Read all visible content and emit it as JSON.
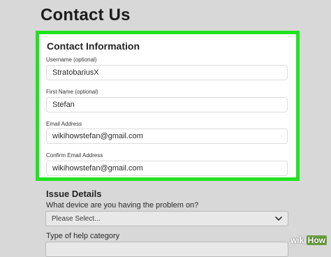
{
  "page": {
    "title": "Contact Us"
  },
  "contact_info": {
    "heading": "Contact Information",
    "fields": [
      {
        "label": "Username (optional)",
        "value": "StratobariusX"
      },
      {
        "label": "First Name (optional)",
        "value": "Stefan"
      },
      {
        "label": "Email Address",
        "value": "wikihowstefan@gmail.com"
      },
      {
        "label": "Confirm Email Address",
        "value": "wikihowstefan@gmail.com"
      }
    ]
  },
  "issue_details": {
    "heading": "Issue Details",
    "device_question": "What device are you having the problem on?",
    "device_select_value": "Please Select...",
    "help_category_question": "Type of help category"
  },
  "watermark": {
    "wiki": "wiki",
    "how": "How"
  },
  "colors": {
    "highlight": "#21e21f",
    "background": "#d8d8d8"
  }
}
